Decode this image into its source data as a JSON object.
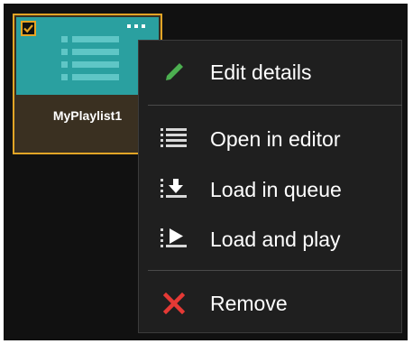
{
  "tile": {
    "name": "MyPlaylist1",
    "checked": true,
    "more_label": "•••",
    "icons": {
      "checkbox": "checkmark-icon",
      "more": "more-options-icon",
      "thumbnail": "playlist-list-icon"
    },
    "colors": {
      "border": "#e2a526",
      "thumbnail": "#2aa0a0",
      "background": "#3a3021"
    }
  },
  "menu": {
    "items": [
      {
        "label": "Edit details",
        "icon": "pencil-icon",
        "icon_color": "#4caf50"
      },
      {
        "label": "Open in editor",
        "icon": "list-icon",
        "icon_color": "#d8d8d8"
      },
      {
        "label": "Load in queue",
        "icon": "load-in-queue-icon",
        "icon_color": "#d8d8d8"
      },
      {
        "label": "Load and play",
        "icon": "load-and-play-icon",
        "icon_color": "#d8d8d8"
      },
      {
        "label": "Remove",
        "icon": "close-x-icon",
        "icon_color": "#e53935"
      }
    ]
  }
}
